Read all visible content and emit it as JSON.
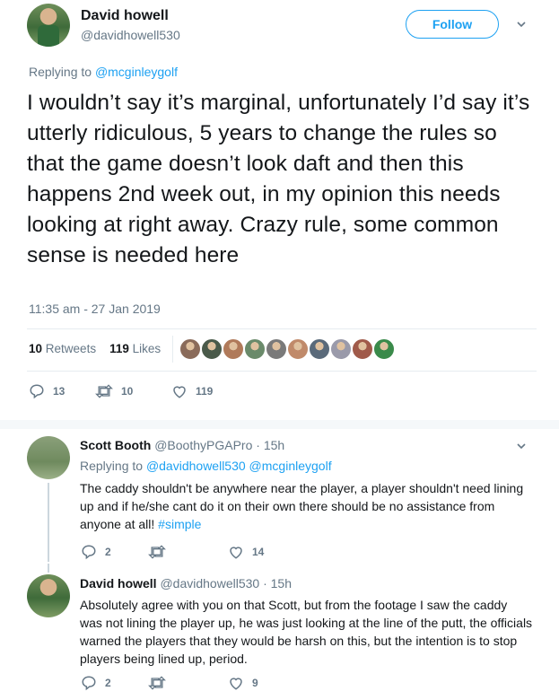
{
  "tweet": {
    "author_name": "David howell",
    "author_handle": "@davidhowell530",
    "follow_label": "Follow",
    "replying_prefix": "Replying to",
    "replying_to": "@mcginleygolf",
    "text": "I wouldn’t say it’s marginal, unfortunately I’d say it’s utterly ridiculous, 5 years to change the rules so that the game doesn’t look daft and then this happens 2nd week out, in my opinion this needs looking at right away. Crazy rule, some common sense is needed here",
    "timestamp": "11:35 am - 27 Jan 2019",
    "retweets_count": "10",
    "retweets_label": "Retweets",
    "likes_count": "119",
    "likes_label": "Likes",
    "liker_colors": [
      "#8a6b5a",
      "#4a5a4a",
      "#b07a5a",
      "#6a8a6a",
      "#7a7a7a",
      "#c08a6a",
      "#5a6a7a",
      "#9a9aaa",
      "#a05a4a",
      "#3a8a4a"
    ],
    "actions": {
      "replies": "13",
      "retweets": "10",
      "likes": "119"
    }
  },
  "replies": [
    {
      "name": "Scott Booth",
      "handle": "@BoothyPGAPro",
      "time": "· 15h",
      "replying_prefix": "Replying to",
      "replying_to": "@davidhowell530 @mcginleygolf",
      "text_main": "The caddy shouldn't be anywhere near the player, a player shouldn't need lining up and if he/she cant do it on their own there should be no assistance from anyone at all! ",
      "hashtag": "#simple",
      "actions": {
        "replies": "2",
        "retweets": "",
        "likes": "14"
      }
    },
    {
      "name": "David howell",
      "handle": "@davidhowell530",
      "time": "· 15h",
      "text_main": "Absolutely agree with you on that Scott, but from the footage I saw the caddy was not lining the player up, he was just looking at the line of the putt, the officials warned the players that they would be harsh on this, but the intention is to stop players being lined up, period.",
      "actions": {
        "replies": "2",
        "retweets": "",
        "likes": "9"
      }
    }
  ]
}
